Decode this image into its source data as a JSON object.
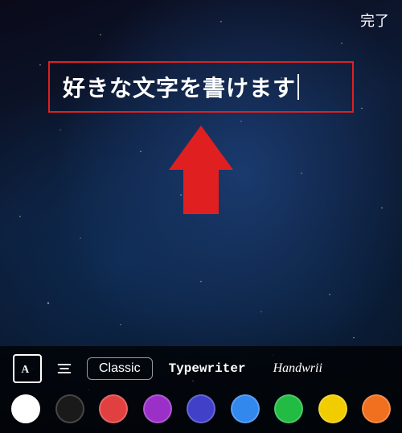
{
  "topBar": {
    "doneLabel": "完了"
  },
  "textInput": {
    "value": "好きな文字を書けます"
  },
  "fontTools": [
    {
      "id": "font-size-icon",
      "type": "icon"
    },
    {
      "id": "align-icon",
      "type": "icon"
    }
  ],
  "fonts": [
    {
      "id": "classic",
      "label": "Classic",
      "style": "serif",
      "active": false,
      "bordered": true
    },
    {
      "id": "typewriter",
      "label": "Typewriter",
      "style": "monospace",
      "active": true,
      "bordered": false
    },
    {
      "id": "handwriting",
      "label": "Handwrii",
      "style": "cursive",
      "active": false,
      "bordered": false
    }
  ],
  "colors": [
    {
      "id": "white",
      "hex": "#ffffff",
      "selected": true
    },
    {
      "id": "black",
      "hex": "#1a1a1a",
      "selected": false
    },
    {
      "id": "red",
      "hex": "#e04040",
      "selected": false
    },
    {
      "id": "purple",
      "hex": "#9b30c8",
      "selected": false
    },
    {
      "id": "indigo",
      "hex": "#4040c8",
      "selected": false
    },
    {
      "id": "blue",
      "hex": "#3388ee",
      "selected": false
    },
    {
      "id": "green",
      "hex": "#22bb44",
      "selected": false
    },
    {
      "id": "yellow",
      "hex": "#f0cc00",
      "selected": false
    },
    {
      "id": "orange",
      "hex": "#f07020",
      "selected": false
    }
  ],
  "accent": {
    "red": "#e02020"
  }
}
